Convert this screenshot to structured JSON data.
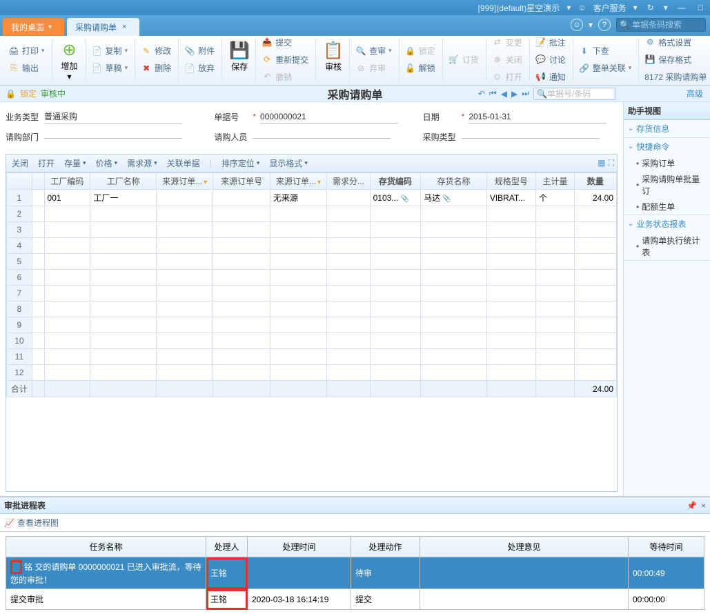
{
  "titlebar": {
    "context": "[999](default)星空演示",
    "service": "客户服务"
  },
  "tabs": {
    "desktop": "我的桌面",
    "doc": "采购请购单"
  },
  "search": {
    "placeholder": "单据条码搜索"
  },
  "ribbon": {
    "print": "打印",
    "output": "输出",
    "add": "增加",
    "copy": "复制",
    "draft": "草稿",
    "modify": "修改",
    "delete": "删除",
    "attach": "附件",
    "discard": "放弃",
    "save": "保存",
    "submit": "提交",
    "resubmit": "重新提交",
    "revoke": "撤销",
    "audit": "审核",
    "review": "查审",
    "abandon": "弃审",
    "lock": "锁定",
    "unlock": "解锁",
    "order": "订货",
    "change": "变更",
    "close": "关闭",
    "open": "打开",
    "approve": "批注",
    "discuss": "讨论",
    "notify": "通知",
    "download": "下查",
    "adjust": "整单关联",
    "format": "格式设置",
    "saveformat": "保存格式",
    "formatcode": "8172 采购请购单"
  },
  "status": {
    "lock": "锁定",
    "auditing": "审核中",
    "title": "采购请购单",
    "search_placeholder": "单据号/条码",
    "advanced": "高级"
  },
  "form": {
    "biz_type_label": "业务类型",
    "biz_type_value": "普通采购",
    "doc_no_label": "单据号",
    "doc_no_value": "0000000021",
    "date_label": "日期",
    "date_value": "2015-01-31",
    "dept_label": "请购部门",
    "dept_value": "",
    "person_label": "请购人员",
    "person_value": "",
    "purchase_type_label": "采购类型",
    "purchase_type_value": ""
  },
  "grid_toolbar": {
    "close": "关闭",
    "open": "打开",
    "stock": "存量",
    "price": "价格",
    "demand": "需求源",
    "related": "关联单据",
    "sort": "排序定位",
    "display": "显示格式"
  },
  "grid": {
    "columns": [
      "工厂编码",
      "工厂名称",
      "来源订单...",
      "来源订单号",
      "来源订单...",
      "需求分...",
      "存货编码",
      "存货名称",
      "规格型号",
      "主计量",
      "数量"
    ],
    "rows": [
      {
        "num": "1",
        "c0": "001",
        "c1": "工厂一",
        "c2": "",
        "c3": "",
        "c4": "无来源",
        "c5": "",
        "c6": "0103...",
        "c7": "马达",
        "c8": "VIBRAT...",
        "c9": "个",
        "c10": "24.00"
      }
    ],
    "total_label": "合计",
    "total_qty": "24.00"
  },
  "side": {
    "title": "助手视图",
    "sec1": "存货信息",
    "sec2": "快捷命令",
    "items2": [
      "采购订单",
      "采购请购单批量订",
      "配额生单"
    ],
    "sec3": "业务状态报表",
    "items3": [
      "请购单执行统计表"
    ]
  },
  "bottom": {
    "title": "审批进程表",
    "view_btn": "查看进程图",
    "columns": [
      "任务名称",
      "处理人",
      "处理时间",
      "处理动作",
      "处理意见",
      "等待时间"
    ],
    "rows": [
      {
        "task": "铭 交的请购单 0000000021 已进入审批流，等待您的审批！",
        "person": "王铭",
        "time": "",
        "action": "待审",
        "opinion": "",
        "wait": "00:00:49",
        "highlight": true
      },
      {
        "task": "提交审批",
        "person": "王铭",
        "time": "2020-03-18 16:14:19",
        "action": "提交",
        "opinion": "",
        "wait": "00:00:00",
        "highlight": false
      }
    ]
  }
}
